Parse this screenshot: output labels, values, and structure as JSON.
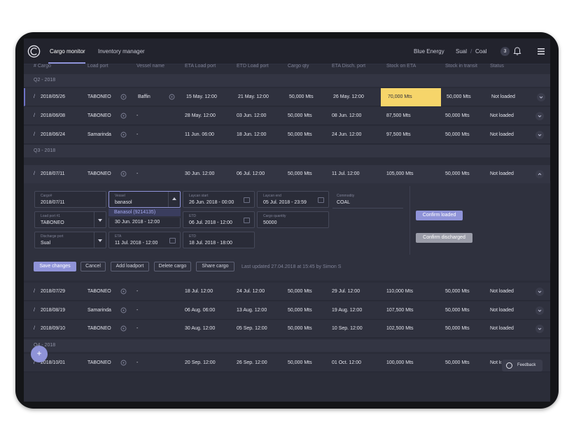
{
  "header": {
    "tabs": [
      {
        "label": "Cargo monitor",
        "active": true
      },
      {
        "label": "Inventory manager",
        "active": false
      }
    ],
    "company": "Blue Energy",
    "location": "Sual",
    "commodity": "Coal",
    "notification_count": "3",
    "accent": "#8f93d8"
  },
  "columns": [
    "# Cargo",
    "Load port",
    "Vessel name",
    "ETA Load port",
    "ETD Load port",
    "Cargo qty",
    "ETA Disch. port",
    "Stock on ETA",
    "Stock in transit",
    "Status"
  ],
  "groups": {
    "g1": "Q2 - 2018",
    "g2": "Q3 - 2018",
    "g3": "Q4 - 2018"
  },
  "rows_q2": [
    {
      "cargo": "2018/05/26",
      "port": "TABONEO",
      "vessel": "Baffin",
      "eta_load": "15 May. 12:00",
      "etd_load": "21 May. 12:00",
      "qty": "50,000 Mts",
      "eta_disch": "26 May. 12:00",
      "stock_eta": "70,000 Mts",
      "stock_transit": "50,000 Mts",
      "status": "Not loaded",
      "highlight_color": "#f6d56a"
    },
    {
      "cargo": "2018/06/08",
      "port": "TABONEO",
      "vessel": "-",
      "eta_load": "28 May. 12:00",
      "etd_load": "03 Jun. 12:00",
      "qty": "50,000 Mts",
      "eta_disch": "08 Jun. 12:00",
      "stock_eta": "87,500 Mts",
      "stock_transit": "50,000 Mts",
      "status": "Not loaded"
    },
    {
      "cargo": "2018/06/24",
      "port": "Samarinda",
      "vessel": "-",
      "eta_load": "11 Jun. 06:00",
      "etd_load": "18 Jun. 12:00",
      "qty": "50,000 Mts",
      "eta_disch": "24 Jun. 12:00",
      "stock_eta": "97,500 Mts",
      "stock_transit": "50,000 Mts",
      "status": "Not loaded"
    }
  ],
  "row_open": {
    "cargo": "2018/07/11",
    "port": "TABONEO",
    "vessel": "-",
    "eta_load": "30 Jun. 12:00",
    "etd_load": "06 Jul. 12:00",
    "qty": "50,000 Mts",
    "eta_disch": "11 Jul. 12:00",
    "stock_eta": "105,000 Mts",
    "stock_transit": "50,000 Mts",
    "status": "Not loaded"
  },
  "editor": {
    "cargo_label": "Cargo#",
    "cargo_value": "2018/07/11",
    "vessel_label": "Vessel",
    "vessel_value": "banasol",
    "vessel_suggestion": "Banasol (9214135)",
    "laycan_start_label": "Laycan start",
    "laycan_start_value": "26 Jun. 2018 - 00:00",
    "laycan_end_label": "Laycan end",
    "laycan_end_value": "05 Jul. 2018 - 23:59",
    "commodity_label": "Commodity",
    "commodity_value": "COAL",
    "loadport_label": "Load port #1",
    "loadport_value": "TABONEO",
    "eta1_value": "30 Jun. 2018 - 12:00",
    "etd1_label": "ETD",
    "etd1_value": "06 Jul. 2018 - 12:00",
    "qty_label": "Cargo quantity",
    "qty_value": "50000",
    "disch_label": "Discharge port",
    "disch_value": "Sual",
    "eta2_label": "ETA",
    "eta2_value": "11 Jul. 2018 - 12:00",
    "etd2_label": "ETD",
    "etd2_value": "18 Jul. 2018 - 18:00",
    "confirm_loaded": "Confirm loaded",
    "confirm_discharged": "Confirm discharged",
    "save": "Save changes",
    "cancel": "Cancel",
    "add_loadport": "Add loadport",
    "delete": "Delete cargo",
    "share": "Share cargo",
    "last_updated": "Last updated 27.04.2018 at 15:45 by Simon S"
  },
  "rows_q3": [
    {
      "cargo": "2018/07/29",
      "port": "TABONEO",
      "vessel": "-",
      "eta_load": "18 Jul. 12:00",
      "etd_load": "24 Jul. 12:00",
      "qty": "50,000 Mts",
      "eta_disch": "29 Jul. 12:00",
      "stock_eta": "110,000 Mts",
      "stock_transit": "50,000 Mts",
      "status": "Not loaded"
    },
    {
      "cargo": "2018/08/19",
      "port": "Samarinda",
      "vessel": "-",
      "eta_load": "06 Aug. 06:00",
      "etd_load": "13 Aug. 12:00",
      "qty": "50,000 Mts",
      "eta_disch": "19 Aug. 12:00",
      "stock_eta": "107,500 Mts",
      "stock_transit": "50,000 Mts",
      "status": "Not loaded"
    },
    {
      "cargo": "2018/09/10",
      "port": "TABONEO",
      "vessel": "-",
      "eta_load": "30 Aug. 12:00",
      "etd_load": "05 Sep. 12:00",
      "qty": "50,000 Mts",
      "eta_disch": "10 Sep. 12:00",
      "stock_eta": "102,500 Mts",
      "stock_transit": "50,000 Mts",
      "status": "Not loaded"
    }
  ],
  "rows_q4": [
    {
      "cargo": "2018/10/01",
      "port": "TABONEO",
      "vessel": "-",
      "eta_load": "20 Sep. 12:00",
      "etd_load": "26 Sep. 12:00",
      "qty": "50,000 Mts",
      "eta_disch": "01 Oct. 12:00",
      "stock_eta": "100,000 Mts",
      "stock_transit": "50,000 Mts",
      "status": "Not loaded"
    }
  ],
  "fab_icon": "+",
  "feedback_label": "Feedback"
}
